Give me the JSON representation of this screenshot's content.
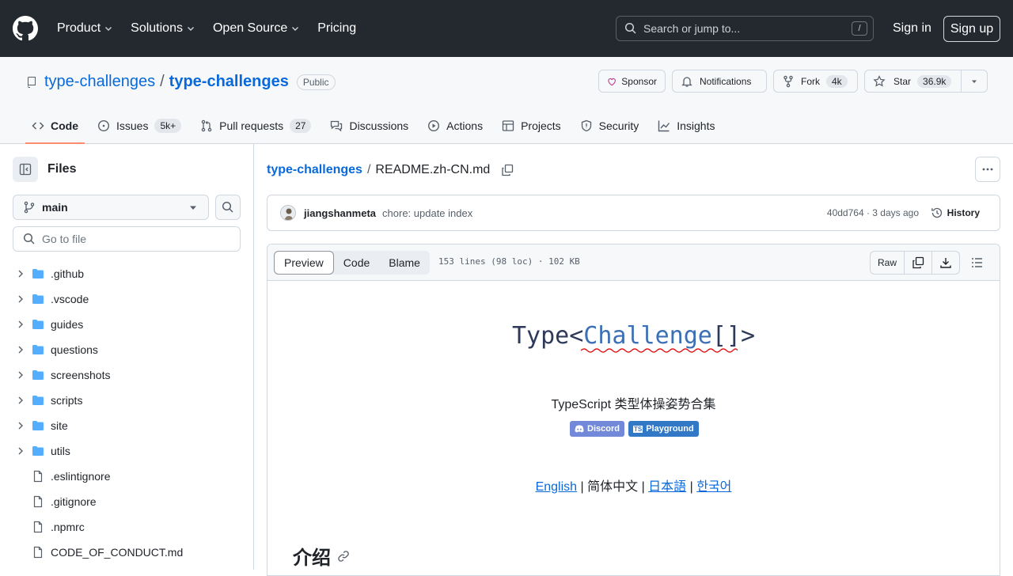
{
  "topnav": {
    "items": [
      {
        "label": "Product",
        "caret": true
      },
      {
        "label": "Solutions",
        "caret": true
      },
      {
        "label": "Open Source",
        "caret": true
      },
      {
        "label": "Pricing",
        "caret": false
      }
    ],
    "search_placeholder": "Search or jump to...",
    "search_shortcut": "/",
    "signin": "Sign in",
    "signup": "Sign up"
  },
  "repo": {
    "owner": "type-challenges",
    "separator": "/",
    "name": "type-challenges",
    "visibility": "Public",
    "sponsor": "Sponsor",
    "notifications": "Notifications",
    "fork": "Fork",
    "fork_count": "4k",
    "star": "Star",
    "star_count": "36.9k"
  },
  "tabs": [
    {
      "label": "Code",
      "count": "",
      "active": true,
      "icon": "code-icon"
    },
    {
      "label": "Issues",
      "count": "5k+",
      "active": false,
      "icon": "issue-icon"
    },
    {
      "label": "Pull requests",
      "count": "27",
      "active": false,
      "icon": "pull-request-icon"
    },
    {
      "label": "Discussions",
      "count": "",
      "active": false,
      "icon": "discussion-icon"
    },
    {
      "label": "Actions",
      "count": "",
      "active": false,
      "icon": "play-icon"
    },
    {
      "label": "Projects",
      "count": "",
      "active": false,
      "icon": "table-icon"
    },
    {
      "label": "Security",
      "count": "",
      "active": false,
      "icon": "shield-icon"
    },
    {
      "label": "Insights",
      "count": "",
      "active": false,
      "icon": "graph-icon"
    }
  ],
  "sidebar": {
    "title": "Files",
    "branch": "main",
    "goto_placeholder": "Go to file",
    "tree": [
      {
        "name": ".github",
        "type": "dir"
      },
      {
        "name": ".vscode",
        "type": "dir"
      },
      {
        "name": "guides",
        "type": "dir"
      },
      {
        "name": "questions",
        "type": "dir"
      },
      {
        "name": "screenshots",
        "type": "dir"
      },
      {
        "name": "scripts",
        "type": "dir"
      },
      {
        "name": "site",
        "type": "dir"
      },
      {
        "name": "utils",
        "type": "dir"
      },
      {
        "name": ".eslintignore",
        "type": "file"
      },
      {
        "name": ".gitignore",
        "type": "file"
      },
      {
        "name": ".npmrc",
        "type": "file"
      },
      {
        "name": "CODE_OF_CONDUCT.md",
        "type": "file"
      }
    ]
  },
  "file": {
    "repo_link": "type-challenges",
    "separator": "/",
    "filename": "README.zh-CN.md",
    "commit_author": "jiangshanmeta",
    "commit_message": "chore: update index",
    "commit_meta": "40dd764 · 3 days ago",
    "history": "History",
    "view_tabs": [
      "Preview",
      "Code",
      "Blame"
    ],
    "info": "153 lines (98 loc) · 102 KB",
    "raw": "Raw"
  },
  "readme": {
    "logo_pre": "Type<",
    "logo_mid": "Challenge",
    "logo_post": "[]>",
    "subtitle": "TypeScript 类型体操姿势合集",
    "badge_discord": "Discord",
    "badge_playground": "Playground",
    "lang_english": "English",
    "lang_sep": " | ",
    "lang_zh": "简体中文",
    "lang_ja": "日本語",
    "lang_ko": "한국어",
    "intro_heading": "介绍"
  },
  "colors": {
    "header_bg": "#24292f",
    "link": "#0969da",
    "discord_badge": "#7289da",
    "playground_badge": "#3178c6",
    "active_tab_underline": "#fd8c73"
  }
}
